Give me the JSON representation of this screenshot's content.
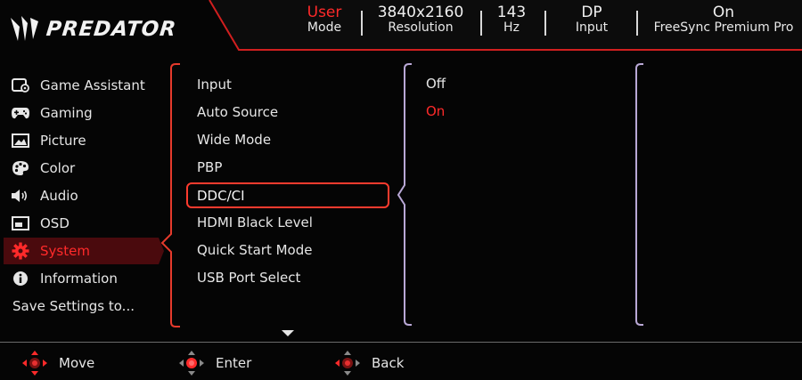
{
  "header": {
    "brand": "PREDATOR",
    "stats": [
      {
        "value": "User",
        "label": "Mode"
      },
      {
        "value": "3840x2160",
        "label": "Resolution"
      },
      {
        "value": "143",
        "label": "Hz"
      },
      {
        "value": "DP",
        "label": "Input"
      },
      {
        "value": "On",
        "label": "FreeSync Premium Pro"
      }
    ]
  },
  "menu": {
    "items": [
      {
        "label": "Game Assistant",
        "icon": "game-assistant-icon"
      },
      {
        "label": "Gaming",
        "icon": "gamepad-icon"
      },
      {
        "label": "Picture",
        "icon": "picture-icon"
      },
      {
        "label": "Color",
        "icon": "palette-icon"
      },
      {
        "label": "Audio",
        "icon": "speaker-icon"
      },
      {
        "label": "OSD",
        "icon": "osd-icon"
      },
      {
        "label": "System",
        "icon": "gear-icon",
        "active": true
      },
      {
        "label": "Information",
        "icon": "info-icon"
      },
      {
        "label": "Save Settings to..."
      }
    ]
  },
  "submenu": {
    "items": [
      "Input",
      "Auto Source",
      "Wide Mode",
      "PBP",
      "DDC/CI",
      "HDMI Black Level",
      "Quick Start Mode",
      "USB Port Select"
    ],
    "selected": "DDC/CI"
  },
  "options": {
    "items": [
      "Off",
      "On"
    ],
    "selected": "On"
  },
  "footer": {
    "move": "Move",
    "enter": "Enter",
    "back": "Back"
  },
  "colors": {
    "accent": "#ff2a2a",
    "active_bg": "#4a0a0d",
    "bracket_red": "#e53a2c",
    "bracket_purple": "#b9a8d6"
  }
}
